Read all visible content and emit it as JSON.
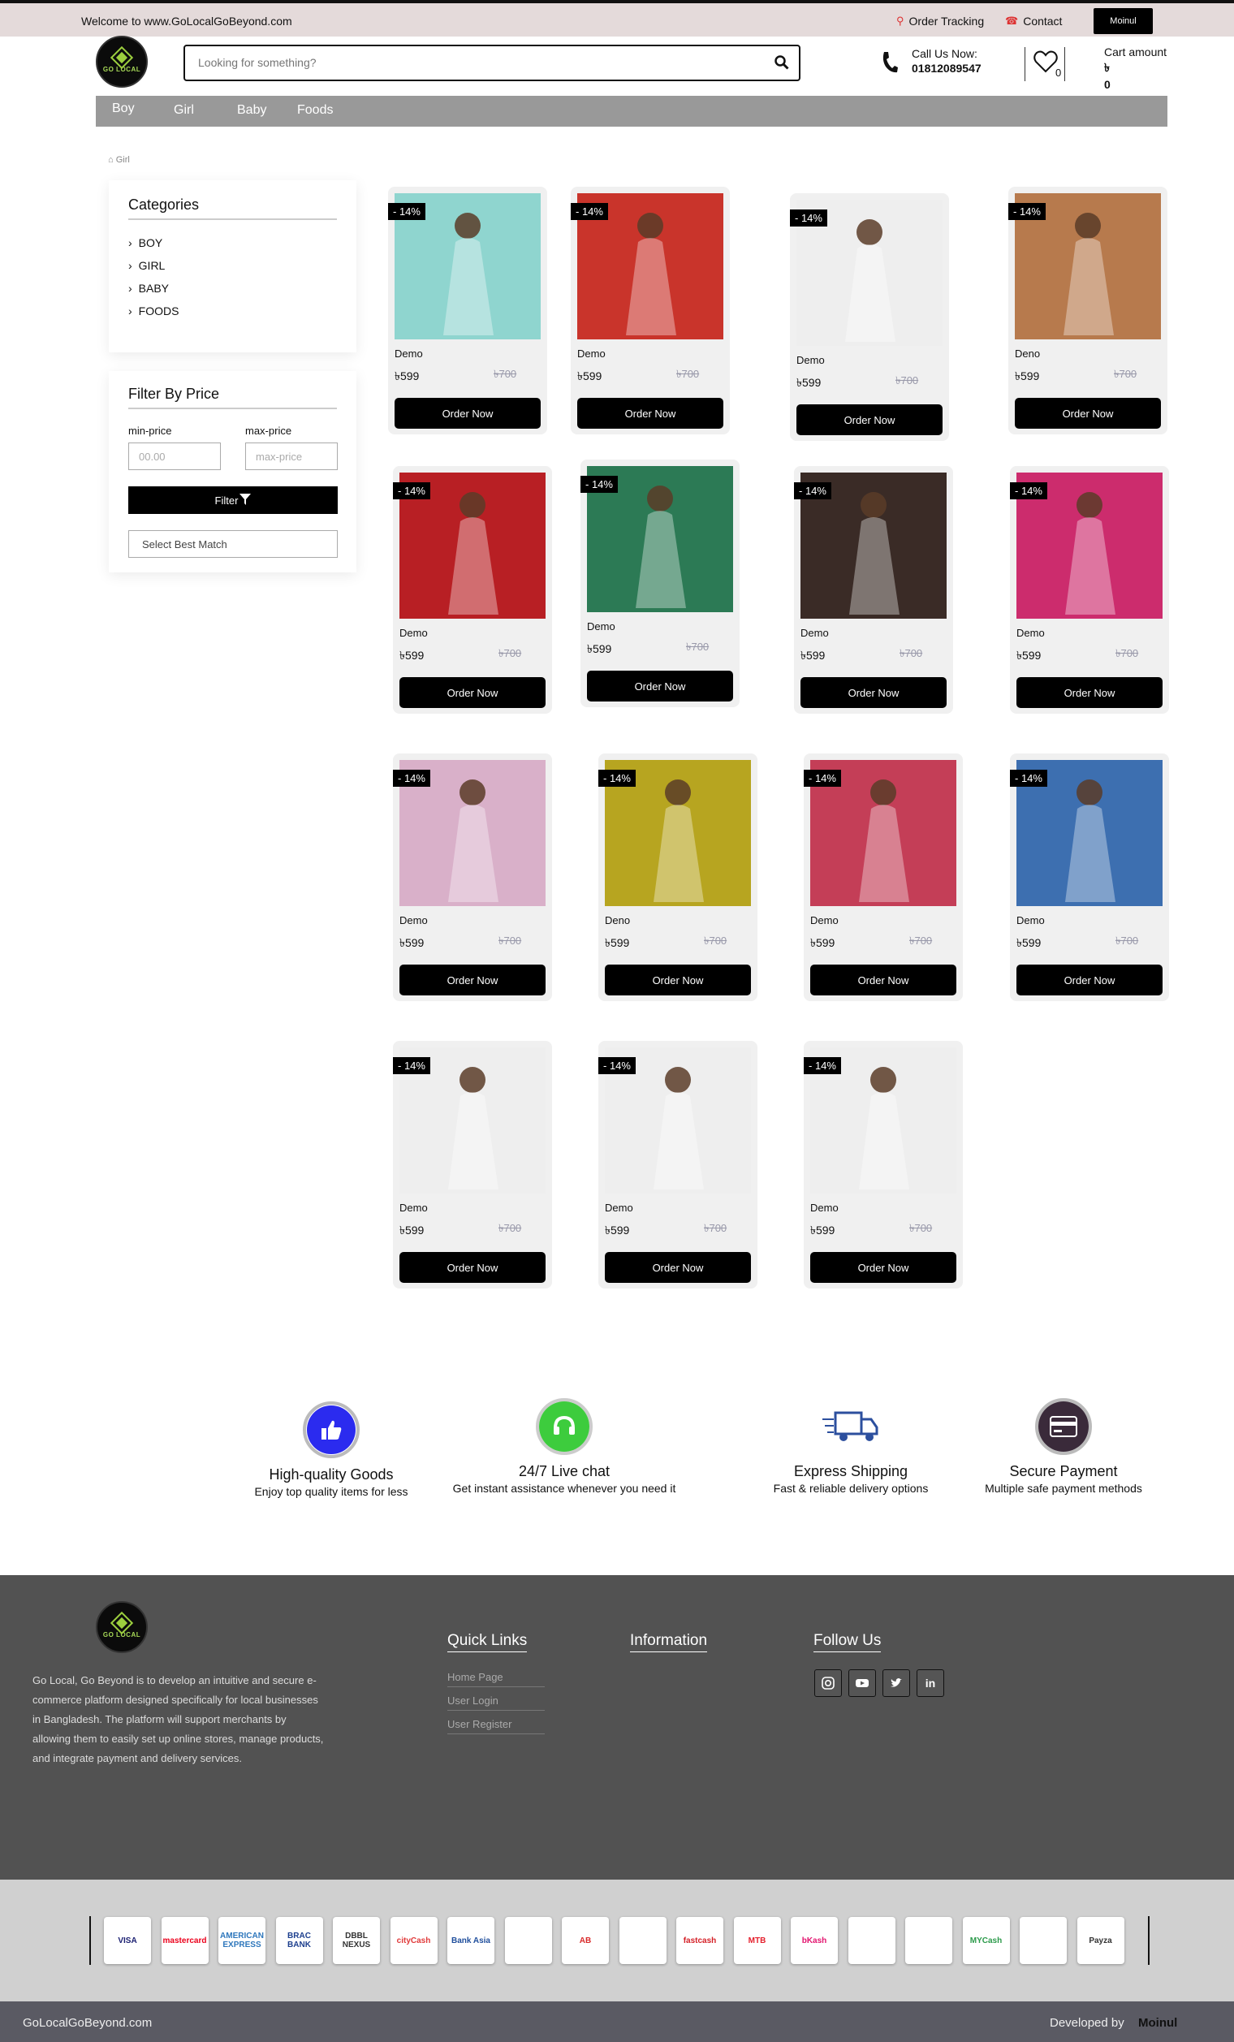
{
  "topbar": {
    "welcome": "Welcome to www.GoLocalGoBeyond.com",
    "order_tracking": "Order Tracking",
    "contact": "Contact",
    "user": "Moinul"
  },
  "header": {
    "logo_text": "GO LOCAL",
    "search_placeholder": "Looking for something?",
    "call_label": "Call Us Now:",
    "call_number": "01812089547",
    "wishlist_count": "0",
    "cart_label": "Cart amount",
    "cart_currency": "৳",
    "cart_amount": "0"
  },
  "nav": {
    "items": [
      "Boy",
      "Girl",
      "Baby",
      "Foods"
    ]
  },
  "breadcrumb": "Girl",
  "categories": {
    "title": "Categories",
    "items": [
      "BOY",
      "GIRL",
      "BABY",
      "FOODS"
    ]
  },
  "filter": {
    "title": "Filter By Price",
    "min_label": "min-price",
    "max_label": "max-price",
    "min_placeholder": "00.00",
    "max_placeholder": "max-price",
    "button": "Filter",
    "select": "Select Best Match"
  },
  "products": [
    {
      "badge": "- 14%",
      "name": "Demo",
      "price": "৳599",
      "old": "৳700",
      "button": "Order Now"
    },
    {
      "badge": "- 14%",
      "name": "Demo",
      "price": "৳599",
      "old": "৳700",
      "button": "Order Now"
    },
    {
      "badge": "- 14%",
      "name": "Demo",
      "price": "৳599",
      "old": "৳700",
      "button": "Order Now"
    },
    {
      "badge": "- 14%",
      "name": "Deno",
      "price": "৳599",
      "old": "৳700",
      "button": "Order Now"
    },
    {
      "badge": "- 14%",
      "name": "Demo",
      "price": "৳599",
      "old": "৳700",
      "button": "Order Now"
    },
    {
      "badge": "- 14%",
      "name": "Demo",
      "price": "৳599",
      "old": "৳700",
      "button": "Order Now"
    },
    {
      "badge": "- 14%",
      "name": "Demo",
      "price": "৳599",
      "old": "৳700",
      "button": "Order Now"
    },
    {
      "badge": "- 14%",
      "name": "Demo",
      "price": "৳599",
      "old": "৳700",
      "button": "Order Now"
    },
    {
      "badge": "- 14%",
      "name": "Demo",
      "price": "৳599",
      "old": "৳700",
      "button": "Order Now"
    },
    {
      "badge": "- 14%",
      "name": "Deno",
      "price": "৳599",
      "old": "৳700",
      "button": "Order Now"
    },
    {
      "badge": "- 14%",
      "name": "Demo",
      "price": "৳599",
      "old": "৳700",
      "button": "Order Now"
    },
    {
      "badge": "- 14%",
      "name": "Demo",
      "price": "৳599",
      "old": "৳700",
      "button": "Order Now"
    },
    {
      "badge": "- 14%",
      "name": "Demo",
      "price": "৳599",
      "old": "৳700",
      "button": "Order Now"
    },
    {
      "badge": "- 14%",
      "name": "Demo",
      "price": "৳599",
      "old": "৳700",
      "button": "Order Now"
    },
    {
      "badge": "- 14%",
      "name": "Demo",
      "price": "৳599",
      "old": "৳700",
      "button": "Order Now"
    }
  ],
  "features": [
    {
      "title": "High-quality Goods",
      "sub": "Enjoy top quality items for less",
      "color": "#2b2bef"
    },
    {
      "title": "24/7 Live chat",
      "sub": "Get instant assistance whenever you need it",
      "color": "#3dcc3d"
    },
    {
      "title": "Express Shipping",
      "sub": "Fast & reliable delivery options",
      "color": "#ffffff"
    },
    {
      "title": "Secure Payment",
      "sub": "Multiple safe payment methods",
      "color": "#3a2a3a"
    }
  ],
  "footer": {
    "about": "Go Local, Go Beyond is to develop an intuitive and secure e-commerce platform designed specifically for local businesses in Bangladesh. The platform will support merchants by allowing them to easily set up online stores, manage products, and integrate payment and delivery services.",
    "quick_links_title": "Quick Links",
    "quick_links": [
      "Home Page",
      "User Login",
      "User Register"
    ],
    "information_title": "Information",
    "follow_title": "Follow Us"
  },
  "payments": [
    "VISA",
    "mastercard",
    "AMERICAN EXPRESS",
    "BRAC BANK",
    "DBBL NEXUS",
    "cityCash",
    "Bank Asia",
    "",
    "AB",
    "",
    "fastcash",
    "MTB",
    "bKash",
    "",
    "",
    "MYCash",
    "",
    "Payza"
  ],
  "bottom": {
    "site": "GoLocalGoBeyond.com",
    "dev_label": "Developed by",
    "dev_name": "Moinul"
  }
}
